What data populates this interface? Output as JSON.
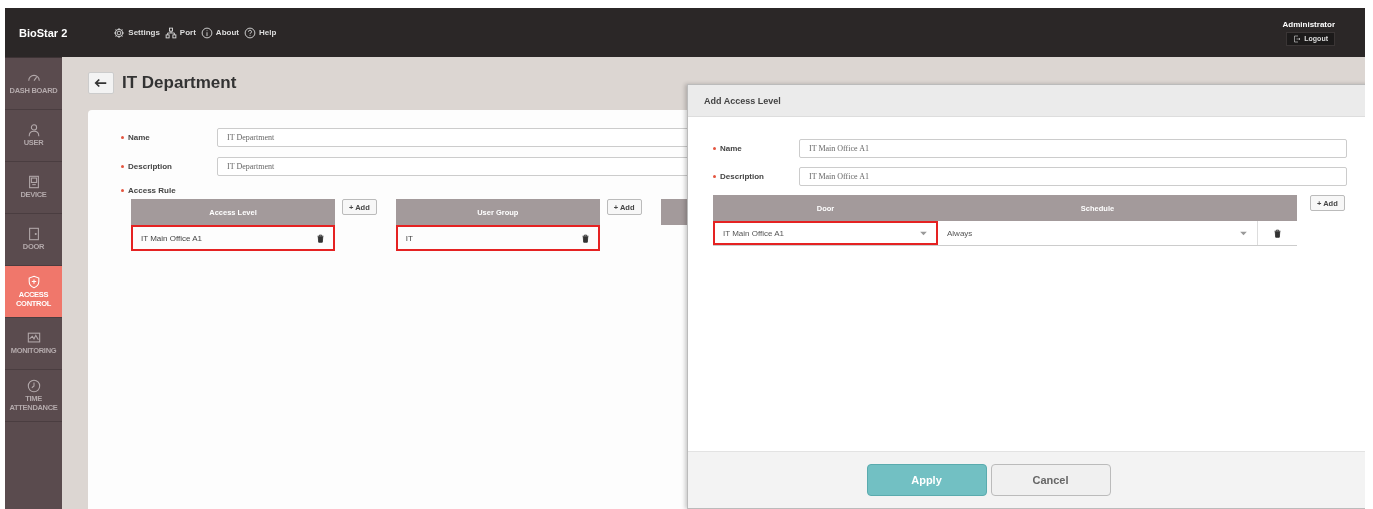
{
  "header": {
    "logo": "BioStar 2",
    "menu": [
      {
        "label": "Settings"
      },
      {
        "label": "Port"
      },
      {
        "label": "About"
      },
      {
        "label": "Help"
      }
    ],
    "user": "Administrator",
    "logout": "Logout"
  },
  "sidebar": {
    "items": [
      {
        "label": "DASH BOARD",
        "selected": false
      },
      {
        "label": "USER",
        "selected": false
      },
      {
        "label": "DEVICE",
        "selected": false
      },
      {
        "label": "DOOR",
        "selected": false
      },
      {
        "label": "ACCESS CONTROL",
        "selected": true
      },
      {
        "label": "MONITORING",
        "selected": false
      },
      {
        "label": "TIME ATTENDANCE",
        "selected": false
      }
    ]
  },
  "page": {
    "title": "IT Department",
    "fields": [
      {
        "label": "Name",
        "value": "IT Department"
      },
      {
        "label": "Description",
        "value": "IT Department"
      }
    ],
    "access_rule": {
      "label": "Access Rule",
      "tables": [
        {
          "column": "Access Level",
          "add": "+ Add",
          "rows": [
            {
              "text": "IT Main Office A1",
              "highlighted": true
            }
          ]
        },
        {
          "column": "User Group",
          "add": "+ Add",
          "rows": [
            {
              "text": "IT",
              "highlighted": true
            }
          ]
        }
      ]
    }
  },
  "dialog": {
    "title": "Add Access Level",
    "fields": [
      {
        "label": "Name",
        "value": "IT Main Office A1"
      },
      {
        "label": "Description",
        "value": "IT Main Office A1"
      }
    ],
    "table": {
      "columns": [
        "Door",
        "Schedule"
      ],
      "add": "+ Add",
      "rows": [
        {
          "door": "IT Main Office A1",
          "door_highlighted": true,
          "schedule": "Always"
        }
      ]
    },
    "buttons": [
      {
        "label": "Apply",
        "kind": "primary"
      },
      {
        "label": "Cancel",
        "kind": "secondary"
      }
    ]
  }
}
